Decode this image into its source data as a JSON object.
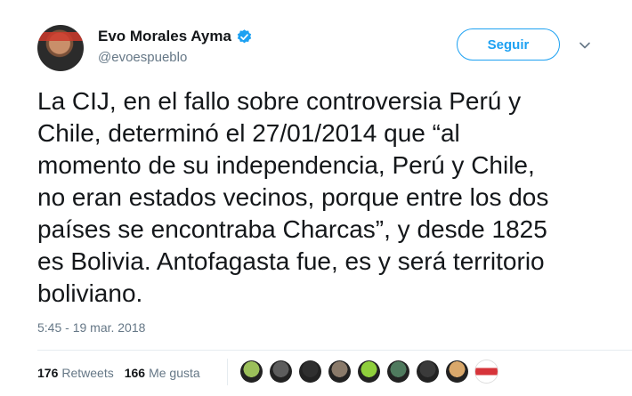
{
  "user": {
    "display_name": "Evo Morales Ayma",
    "handle": "@evoespueblo",
    "verified": true
  },
  "follow_button": {
    "label": "Seguir"
  },
  "tweet": {
    "text": "La CIJ, en el fallo sobre controversia Perú y\nChile, determinó el 27/01/2014 que “al\nmomento de su independencia, Perú y Chile,\nno eran estados vecinos, porque entre los dos\npaíses se encontraba Charcas”, y desde 1825\nes Bolivia. Antofagasta fue, es y será territorio\nboliviano.",
    "timestamp": "5:45 - 19 mar. 2018"
  },
  "stats": {
    "retweets_count": "176",
    "retweets_label": "Retweets",
    "likes_count": "166",
    "likes_label": "Me gusta"
  },
  "likers": [
    {
      "icon": "avatar-cartoon-icon",
      "color": "#9bbf5a"
    },
    {
      "icon": "avatar-photo-icon",
      "color": "#5d5d5d"
    },
    {
      "icon": "avatar-photo-icon",
      "color": "#2f2f2f"
    },
    {
      "icon": "avatar-photo-icon",
      "color": "#8a7a6a"
    },
    {
      "icon": "avatar-alien-icon",
      "color": "#8fcf3c"
    },
    {
      "icon": "avatar-photo-icon",
      "color": "#4f7a5e"
    },
    {
      "icon": "avatar-photo-icon",
      "color": "#3a3a3a"
    },
    {
      "icon": "avatar-photo-icon",
      "color": "#d9a86b"
    },
    {
      "icon": "avatar-flag-icon",
      "color": "#d6343a"
    }
  ],
  "colors": {
    "accent": "#1da1f2",
    "secondary_text": "#657786",
    "primary_text": "#14171a"
  }
}
